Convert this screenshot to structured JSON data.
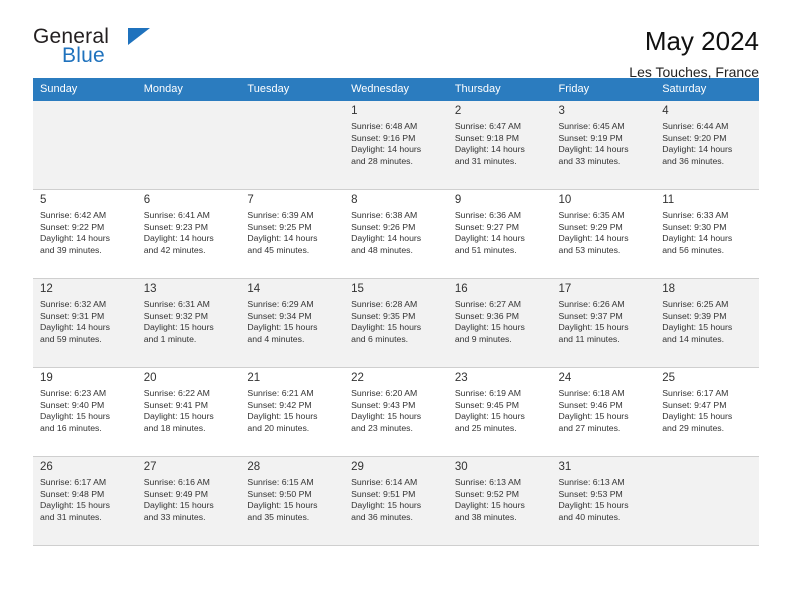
{
  "brand": {
    "name_top": "General",
    "name_bottom": "Blue",
    "accent_color": "#1f72bd"
  },
  "header": {
    "title": "May 2024",
    "location": "Les Touches, France"
  },
  "theme": {
    "header_bg": "#2b7cbf",
    "header_text": "#ffffff",
    "row_alt_bg": "#f2f2f2",
    "row_bg": "#ffffff",
    "grid_line": "#cfcfcf"
  },
  "calendar": {
    "weekdays": [
      "Sunday",
      "Monday",
      "Tuesday",
      "Wednesday",
      "Thursday",
      "Friday",
      "Saturday"
    ],
    "weeks": [
      [
        {
          "day": "",
          "detail": ""
        },
        {
          "day": "",
          "detail": ""
        },
        {
          "day": "",
          "detail": ""
        },
        {
          "day": "1",
          "detail": "Sunrise: 6:48 AM\nSunset: 9:16 PM\nDaylight: 14 hours\nand 28 minutes."
        },
        {
          "day": "2",
          "detail": "Sunrise: 6:47 AM\nSunset: 9:18 PM\nDaylight: 14 hours\nand 31 minutes."
        },
        {
          "day": "3",
          "detail": "Sunrise: 6:45 AM\nSunset: 9:19 PM\nDaylight: 14 hours\nand 33 minutes."
        },
        {
          "day": "4",
          "detail": "Sunrise: 6:44 AM\nSunset: 9:20 PM\nDaylight: 14 hours\nand 36 minutes."
        }
      ],
      [
        {
          "day": "5",
          "detail": "Sunrise: 6:42 AM\nSunset: 9:22 PM\nDaylight: 14 hours\nand 39 minutes."
        },
        {
          "day": "6",
          "detail": "Sunrise: 6:41 AM\nSunset: 9:23 PM\nDaylight: 14 hours\nand 42 minutes."
        },
        {
          "day": "7",
          "detail": "Sunrise: 6:39 AM\nSunset: 9:25 PM\nDaylight: 14 hours\nand 45 minutes."
        },
        {
          "day": "8",
          "detail": "Sunrise: 6:38 AM\nSunset: 9:26 PM\nDaylight: 14 hours\nand 48 minutes."
        },
        {
          "day": "9",
          "detail": "Sunrise: 6:36 AM\nSunset: 9:27 PM\nDaylight: 14 hours\nand 51 minutes."
        },
        {
          "day": "10",
          "detail": "Sunrise: 6:35 AM\nSunset: 9:29 PM\nDaylight: 14 hours\nand 53 minutes."
        },
        {
          "day": "11",
          "detail": "Sunrise: 6:33 AM\nSunset: 9:30 PM\nDaylight: 14 hours\nand 56 minutes."
        }
      ],
      [
        {
          "day": "12",
          "detail": "Sunrise: 6:32 AM\nSunset: 9:31 PM\nDaylight: 14 hours\nand 59 minutes."
        },
        {
          "day": "13",
          "detail": "Sunrise: 6:31 AM\nSunset: 9:32 PM\nDaylight: 15 hours\nand 1 minute."
        },
        {
          "day": "14",
          "detail": "Sunrise: 6:29 AM\nSunset: 9:34 PM\nDaylight: 15 hours\nand 4 minutes."
        },
        {
          "day": "15",
          "detail": "Sunrise: 6:28 AM\nSunset: 9:35 PM\nDaylight: 15 hours\nand 6 minutes."
        },
        {
          "day": "16",
          "detail": "Sunrise: 6:27 AM\nSunset: 9:36 PM\nDaylight: 15 hours\nand 9 minutes."
        },
        {
          "day": "17",
          "detail": "Sunrise: 6:26 AM\nSunset: 9:37 PM\nDaylight: 15 hours\nand 11 minutes."
        },
        {
          "day": "18",
          "detail": "Sunrise: 6:25 AM\nSunset: 9:39 PM\nDaylight: 15 hours\nand 14 minutes."
        }
      ],
      [
        {
          "day": "19",
          "detail": "Sunrise: 6:23 AM\nSunset: 9:40 PM\nDaylight: 15 hours\nand 16 minutes."
        },
        {
          "day": "20",
          "detail": "Sunrise: 6:22 AM\nSunset: 9:41 PM\nDaylight: 15 hours\nand 18 minutes."
        },
        {
          "day": "21",
          "detail": "Sunrise: 6:21 AM\nSunset: 9:42 PM\nDaylight: 15 hours\nand 20 minutes."
        },
        {
          "day": "22",
          "detail": "Sunrise: 6:20 AM\nSunset: 9:43 PM\nDaylight: 15 hours\nand 23 minutes."
        },
        {
          "day": "23",
          "detail": "Sunrise: 6:19 AM\nSunset: 9:45 PM\nDaylight: 15 hours\nand 25 minutes."
        },
        {
          "day": "24",
          "detail": "Sunrise: 6:18 AM\nSunset: 9:46 PM\nDaylight: 15 hours\nand 27 minutes."
        },
        {
          "day": "25",
          "detail": "Sunrise: 6:17 AM\nSunset: 9:47 PM\nDaylight: 15 hours\nand 29 minutes."
        }
      ],
      [
        {
          "day": "26",
          "detail": "Sunrise: 6:17 AM\nSunset: 9:48 PM\nDaylight: 15 hours\nand 31 minutes."
        },
        {
          "day": "27",
          "detail": "Sunrise: 6:16 AM\nSunset: 9:49 PM\nDaylight: 15 hours\nand 33 minutes."
        },
        {
          "day": "28",
          "detail": "Sunrise: 6:15 AM\nSunset: 9:50 PM\nDaylight: 15 hours\nand 35 minutes."
        },
        {
          "day": "29",
          "detail": "Sunrise: 6:14 AM\nSunset: 9:51 PM\nDaylight: 15 hours\nand 36 minutes."
        },
        {
          "day": "30",
          "detail": "Sunrise: 6:13 AM\nSunset: 9:52 PM\nDaylight: 15 hours\nand 38 minutes."
        },
        {
          "day": "31",
          "detail": "Sunrise: 6:13 AM\nSunset: 9:53 PM\nDaylight: 15 hours\nand 40 minutes."
        },
        {
          "day": "",
          "detail": ""
        }
      ]
    ]
  }
}
